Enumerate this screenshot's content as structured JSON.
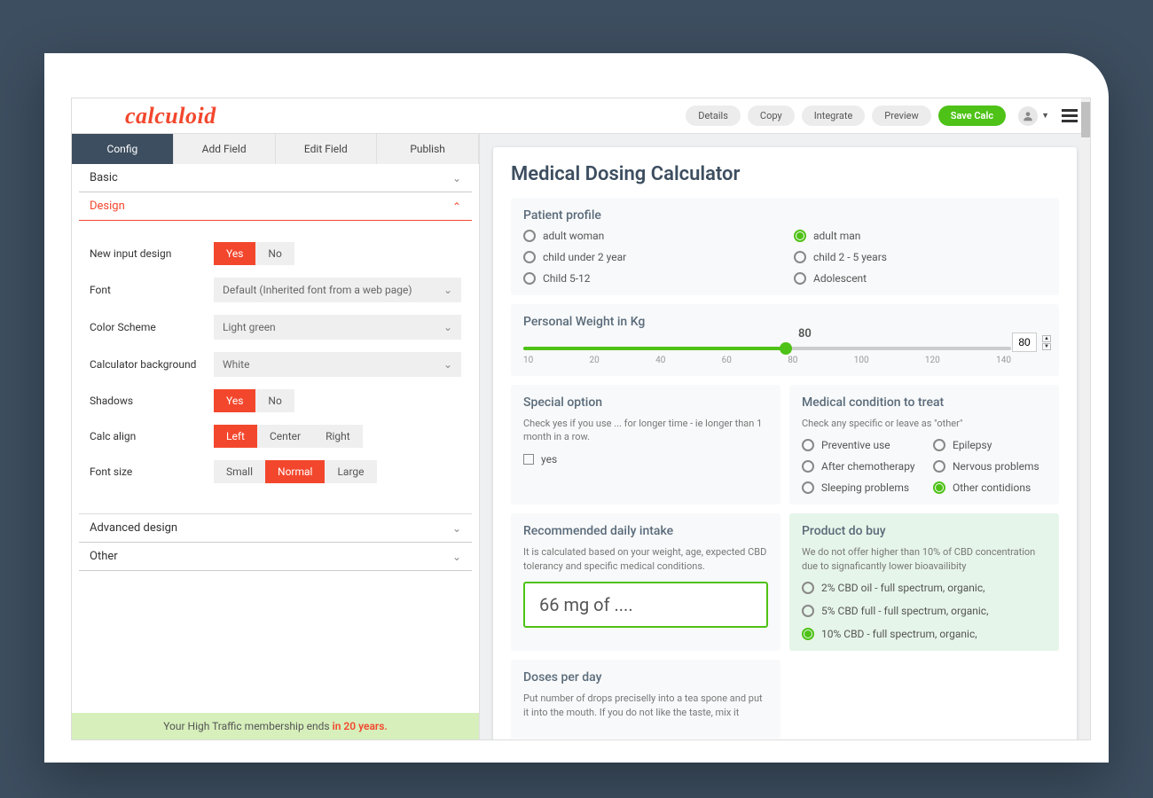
{
  "logo": "calculoid",
  "topbar": {
    "details": "Details",
    "copy": "Copy",
    "integrate": "Integrate",
    "preview": "Preview",
    "save": "Save Calc"
  },
  "tabs": {
    "config": "Config",
    "addField": "Add Field",
    "editField": "Edit Field",
    "publish": "Publish"
  },
  "accordion": {
    "basic": "Basic",
    "design": "Design",
    "advanced": "Advanced design",
    "other": "Other"
  },
  "design": {
    "newInputLabel": "New input design",
    "fontLabel": "Font",
    "fontValue": "Default (Inherited font from a web page)",
    "colorSchemeLabel": "Color Scheme",
    "colorSchemeValue": "Light green",
    "bgLabel": "Calculator background",
    "bgValue": "White",
    "shadowsLabel": "Shadows",
    "alignLabel": "Calc align",
    "fontSizeLabel": "Font size",
    "yes": "Yes",
    "no": "No",
    "left": "Left",
    "center": "Center",
    "right": "Right",
    "small": "Small",
    "normal": "Normal",
    "large": "Large"
  },
  "membership": {
    "prefix": "Your High Traffic membership ends ",
    "highlight": "in 20 years."
  },
  "calc": {
    "title": "Medical Dosing Calculator",
    "patientProfile": {
      "title": "Patient profile",
      "options": [
        "adult woman",
        "adult man",
        "child under 2 year",
        "child 2 - 5 years",
        "Child 5-12",
        "Adolescent"
      ],
      "selected": "adult man"
    },
    "weight": {
      "title": "Personal Weight in Kg",
      "value": "80",
      "min": 10,
      "max": 140,
      "ticks": [
        "10",
        "20",
        "40",
        "60",
        "80",
        "100",
        "120",
        "140"
      ]
    },
    "specialOption": {
      "title": "Special option",
      "desc": "Check yes if you use ... for longer time - ie longer than 1 month in a row.",
      "checkboxLabel": "yes"
    },
    "condition": {
      "title": "Medical condition to treat",
      "desc": "Check any specific or leave as \"other\"",
      "options": [
        "Preventive use",
        "Epilepsy",
        "After chemotherapy",
        "Nervous problems",
        "Sleeping problems",
        "Other contidions"
      ],
      "selected": "Other contidions"
    },
    "intake": {
      "title": "Recommended daily intake",
      "desc": "It is calculated based on your weight, age, expected CBD tolerancy and specific medical conditions.",
      "result": "66 mg of ...."
    },
    "product": {
      "title": "Product do buy",
      "desc": "We do not offer higher than 10% of CBD concentration due to signaficantly lower bioavailibity",
      "options": [
        "2% CBD oil - full spectrum, organic,",
        "5% CBD full - full spectrum, organic,",
        "10% CBD - full spectrum, organic,"
      ],
      "selected": "10% CBD - full spectrum, organic,"
    },
    "doses": {
      "title": "Doses per day",
      "desc": "Put number of drops preciselly into a tea spone and put it into the mouth. If you do not like the taste, mix it"
    }
  }
}
